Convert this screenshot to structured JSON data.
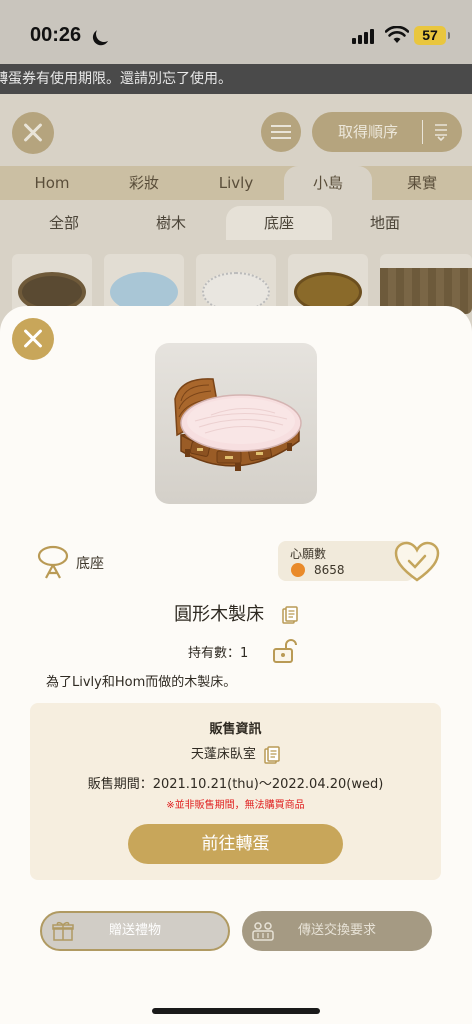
{
  "status_bar": {
    "time": "00:26",
    "battery": "57"
  },
  "background": {
    "notice": "轉蛋券有使用期限。還請別忘了使用。",
    "sort_label": "取得順序",
    "tabs": [
      "Hom",
      "彩妝",
      "Livly",
      "小島",
      "果實"
    ],
    "sub_tabs": [
      "全部",
      "樹木",
      "底座",
      "地面"
    ]
  },
  "item": {
    "category": "底座",
    "wishlist_label": "心願數",
    "wishlist_count": "8658",
    "name": "圓形木製床",
    "owned": "持有數：1",
    "description": "為了Livly和Hom而做的木製床。"
  },
  "sales": {
    "title": "販售資訊",
    "shop": "天蓬床臥室",
    "period": "販售期間：2021.10.21(thu)～2022.04.20(wed)",
    "warning": "※並非販售期間，無法購買商品",
    "button": "前往轉蛋"
  },
  "actions": {
    "gift": "贈送禮物",
    "trade": "傳送交換要求"
  },
  "colors": {
    "accent": "#c8a65a",
    "warning": "#e02121",
    "sheet": "#fdfbf7"
  }
}
